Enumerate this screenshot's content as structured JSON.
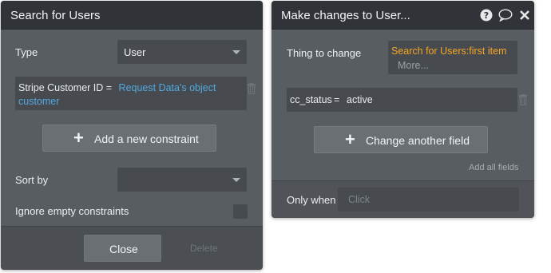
{
  "search_panel": {
    "title": "Search for Users",
    "type_label": "Type",
    "type_value": "User",
    "constraint": {
      "field_text": "Stripe Customer ID =",
      "value_line1": "Request Data's object",
      "value_line2": "customer"
    },
    "add_constraint_label": "Add a new constraint",
    "sort_by_label": "Sort by",
    "sort_by_value": "",
    "ignore_empty_label": "Ignore empty constraints",
    "ignore_empty_checked": false,
    "close_label": "Close",
    "delete_label": "Delete"
  },
  "changes_panel": {
    "title": "Make changes to User...",
    "icons": [
      "help-icon",
      "comment-icon",
      "close-icon"
    ],
    "thing_to_change_label": "Thing to change",
    "thing_to_change_value": "Search for Users:first item",
    "more_label": "More...",
    "field_change": {
      "field": "cc_status",
      "operator": "=",
      "value": "active"
    },
    "change_another_label": "Change another field",
    "add_all_fields_label": "Add all fields",
    "only_when_label": "Only when",
    "only_when_placeholder": "Click"
  },
  "colors": {
    "panel_bg": "#585d62",
    "header_bg": "#303438",
    "field_bg": "#474b4f",
    "link_blue": "#52a8e0",
    "accent_orange": "#f5a623"
  }
}
